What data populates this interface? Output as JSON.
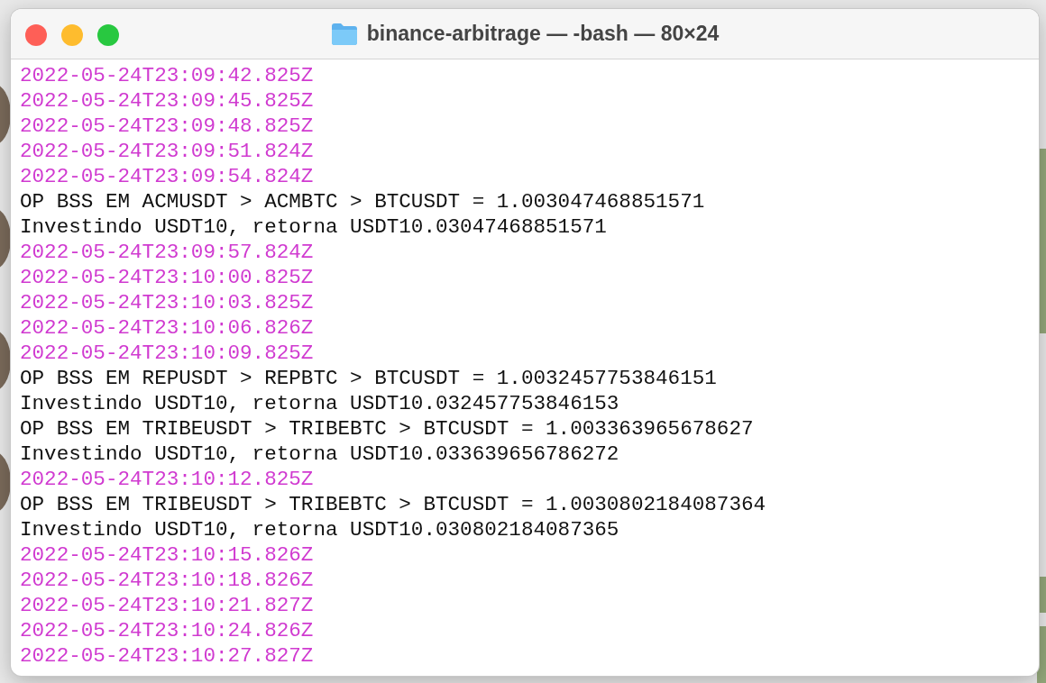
{
  "window": {
    "title": "binance-arbitrage — -bash — 80×24"
  },
  "lines": [
    {
      "kind": "timestamp",
      "text": "2022-05-24T23:09:42.825Z"
    },
    {
      "kind": "timestamp",
      "text": "2022-05-24T23:09:45.825Z"
    },
    {
      "kind": "timestamp",
      "text": "2022-05-24T23:09:48.825Z"
    },
    {
      "kind": "timestamp",
      "text": "2022-05-24T23:09:51.824Z"
    },
    {
      "kind": "timestamp",
      "text": "2022-05-24T23:09:54.824Z"
    },
    {
      "kind": "output",
      "text": "OP BSS EM ACMUSDT > ACMBTC > BTCUSDT = 1.003047468851571"
    },
    {
      "kind": "output",
      "text": "Investindo USDT10, retorna USDT10.03047468851571"
    },
    {
      "kind": "timestamp",
      "text": "2022-05-24T23:09:57.824Z"
    },
    {
      "kind": "timestamp",
      "text": "2022-05-24T23:10:00.825Z"
    },
    {
      "kind": "timestamp",
      "text": "2022-05-24T23:10:03.825Z"
    },
    {
      "kind": "timestamp",
      "text": "2022-05-24T23:10:06.826Z"
    },
    {
      "kind": "timestamp",
      "text": "2022-05-24T23:10:09.825Z"
    },
    {
      "kind": "output",
      "text": "OP BSS EM REPUSDT > REPBTC > BTCUSDT = 1.0032457753846151"
    },
    {
      "kind": "output",
      "text": "Investindo USDT10, retorna USDT10.032457753846153"
    },
    {
      "kind": "output",
      "text": "OP BSS EM TRIBEUSDT > TRIBEBTC > BTCUSDT = 1.003363965678627"
    },
    {
      "kind": "output",
      "text": "Investindo USDT10, retorna USDT10.033639656786272"
    },
    {
      "kind": "timestamp",
      "text": "2022-05-24T23:10:12.825Z"
    },
    {
      "kind": "output",
      "text": "OP BSS EM TRIBEUSDT > TRIBEBTC > BTCUSDT = 1.0030802184087364"
    },
    {
      "kind": "output",
      "text": "Investindo USDT10, retorna USDT10.030802184087365"
    },
    {
      "kind": "timestamp",
      "text": "2022-05-24T23:10:15.826Z"
    },
    {
      "kind": "timestamp",
      "text": "2022-05-24T23:10:18.826Z"
    },
    {
      "kind": "timestamp",
      "text": "2022-05-24T23:10:21.827Z"
    },
    {
      "kind": "timestamp",
      "text": "2022-05-24T23:10:24.826Z"
    },
    {
      "kind": "timestamp",
      "text": "2022-05-24T23:10:27.827Z"
    }
  ]
}
